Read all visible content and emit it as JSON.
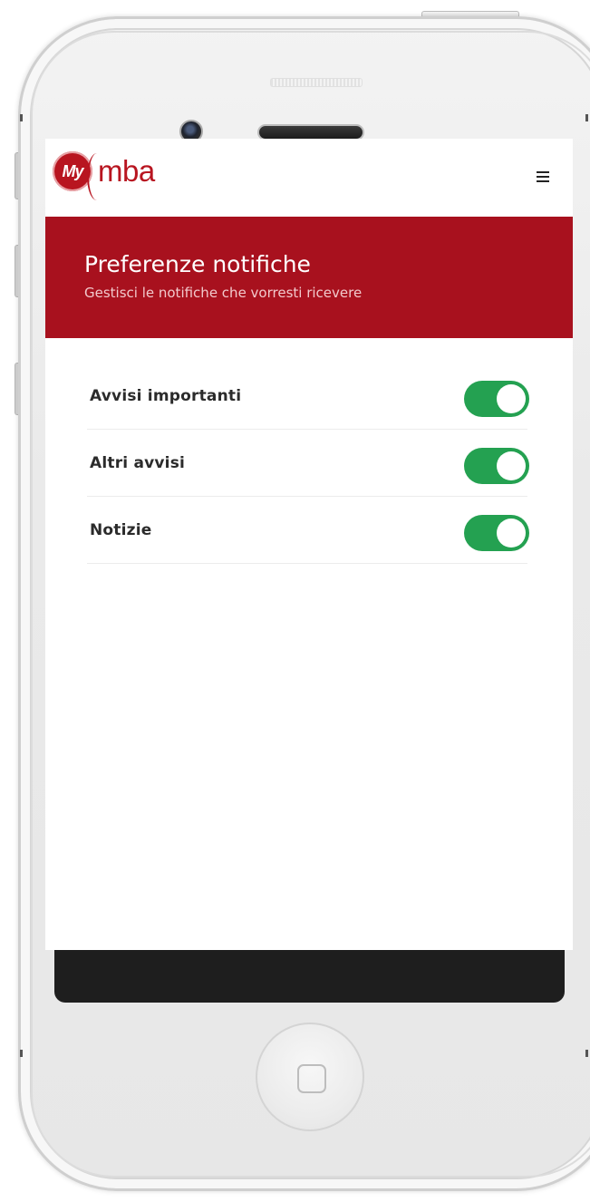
{
  "app": {
    "logo_badge": "My",
    "logo_text": "mba"
  },
  "banner": {
    "title": "Preferenze notifiche",
    "subtitle": "Gestisci le notifiche che vorresti ricevere"
  },
  "settings": [
    {
      "label": "Avvisi importanti",
      "enabled": true
    },
    {
      "label": "Altri avvisi",
      "enabled": true
    },
    {
      "label": "Notizie",
      "enabled": true
    }
  ],
  "icons": {
    "menu": "hamburger-menu-icon",
    "camera": "camera-icon",
    "home": "home-button-icon"
  },
  "colors": {
    "brand_red": "#a8111e",
    "toggle_on": "#24a151"
  }
}
